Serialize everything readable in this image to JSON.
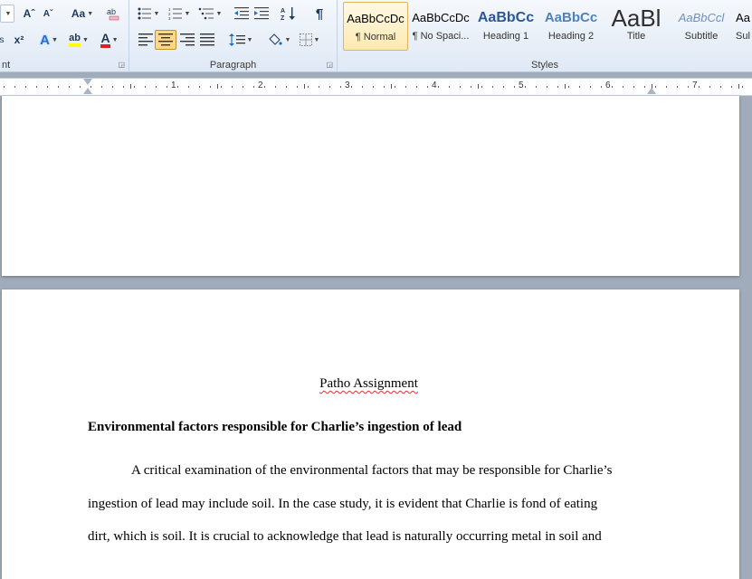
{
  "ribbon": {
    "font_group_label": "nt",
    "paragraph_group_label": "Paragraph",
    "styles_group_label": "Styles",
    "font_buttons": {
      "grow": "Aˆ",
      "shrink": "Aˇ",
      "change_case": "Aa",
      "superscript": "x²",
      "text_effects": "A",
      "highlight": "ab",
      "font_color": "A"
    },
    "highlight_color": "#ffff00",
    "font_color_value": "#e02020",
    "styles": [
      {
        "preview": "AaBbCcDc",
        "name": "¶ Normal",
        "selected": true
      },
      {
        "preview": "AaBbCcDc",
        "name": "¶ No Spaci...",
        "selected": false
      },
      {
        "preview": "AaBbCc",
        "name": "Heading 1",
        "selected": false
      },
      {
        "preview": "AaBbCc",
        "name": "Heading 2",
        "selected": false
      },
      {
        "preview": "AaBl",
        "name": "Title",
        "selected": false
      },
      {
        "preview": "AaBbCcl",
        "name": "Subtitle",
        "selected": false
      },
      {
        "preview": "Aa",
        "name": "Sul",
        "selected": false
      }
    ]
  },
  "ruler": {
    "numbers": [
      "1",
      "2",
      "3",
      "4",
      "5",
      "6",
      "7"
    ]
  },
  "document": {
    "title": "Patho Assignment",
    "heading": "Environmental factors responsible for Charlie’s ingestion of lead",
    "lines": [
      "A critical examination of the environmental factors that may be responsible for Charlie’s",
      "ingestion of lead may include soil.  In the case study, it is evident that Charlie is fond of eating",
      "dirt, which is soil.  It is crucial to acknowledge that lead is naturally occurring metal in soil and"
    ]
  }
}
